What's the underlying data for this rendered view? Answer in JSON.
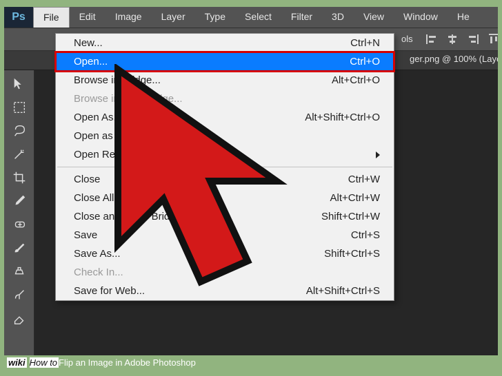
{
  "menubar": {
    "items": [
      "File",
      "Edit",
      "Image",
      "Layer",
      "Type",
      "Select",
      "Filter",
      "3D",
      "View",
      "Window",
      "He"
    ]
  },
  "optionsbar": {
    "ols_label": "ols"
  },
  "doctab": {
    "text": "ger.png @ 100% (Laye"
  },
  "file_menu": {
    "groups": [
      [
        {
          "label": "New...",
          "shortcut": "Ctrl+N",
          "disabled": false,
          "highlight": false
        },
        {
          "label": "Open...",
          "shortcut": "Ctrl+O",
          "disabled": false,
          "highlight": true
        },
        {
          "label": "Browse in Bridge...",
          "shortcut": "Alt+Ctrl+O",
          "disabled": false
        },
        {
          "label": "Browse in Mini Bridge...",
          "shortcut": "",
          "disabled": true
        },
        {
          "label": "Open As...",
          "shortcut": "Alt+Shift+Ctrl+O",
          "disabled": false
        },
        {
          "label": "Open as Smart Object...",
          "shortcut": "",
          "disabled": false
        },
        {
          "label": "Open Recent",
          "shortcut": "",
          "disabled": false,
          "submenu": true
        }
      ],
      [
        {
          "label": "Close",
          "shortcut": "Ctrl+W"
        },
        {
          "label": "Close All",
          "shortcut": "Alt+Ctrl+W"
        },
        {
          "label": "Close and Go to Bridge...",
          "shortcut": "Shift+Ctrl+W"
        },
        {
          "label": "Save",
          "shortcut": "Ctrl+S"
        },
        {
          "label": "Save As...",
          "shortcut": "Shift+Ctrl+S"
        },
        {
          "label": "Check In...",
          "shortcut": "",
          "disabled": true
        },
        {
          "label": "Save for Web...",
          "shortcut": "Alt+Shift+Ctrl+S"
        }
      ]
    ]
  },
  "footer": {
    "brand1": "wiki",
    "brand2": "How to ",
    "title": "Flip an Image in Adobe Photoshop"
  }
}
